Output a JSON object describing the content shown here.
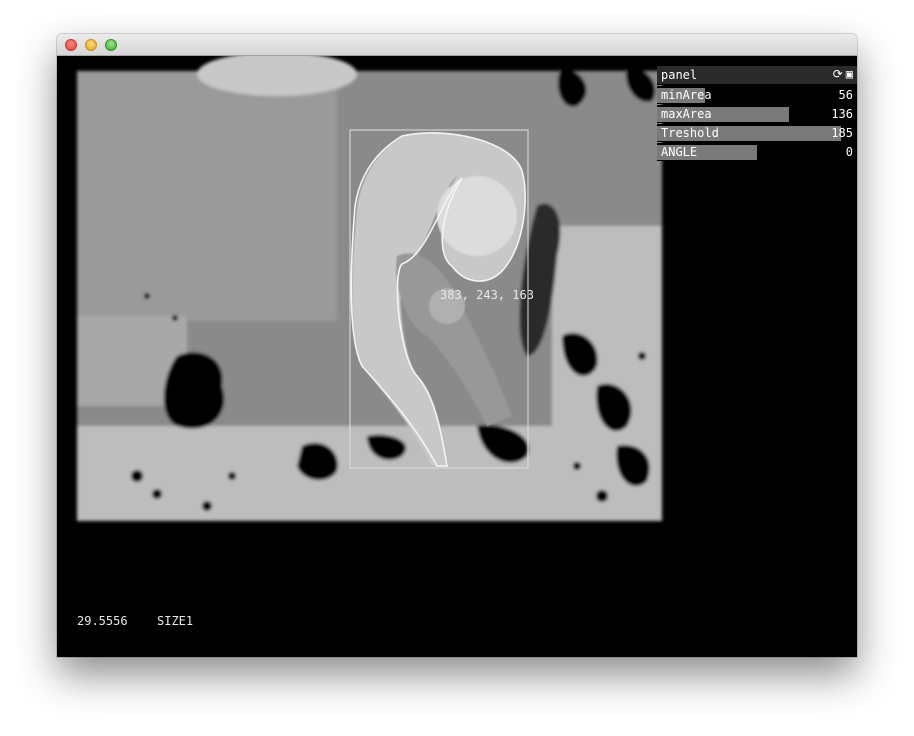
{
  "window": {
    "title": "",
    "controls": [
      "close",
      "minimize",
      "zoom"
    ]
  },
  "panel": {
    "title": "panel",
    "icons": [
      "refresh-icon",
      "save-icon"
    ],
    "sliders": [
      {
        "label": "minArea",
        "value": "56",
        "fill": 0.25
      },
      {
        "label": "maxArea",
        "value": "136",
        "fill": 0.66
      },
      {
        "label": "Treshold",
        "value": "185",
        "fill": 0.92
      },
      {
        "label": "ANGLE",
        "value": "0",
        "fill": 0.5
      }
    ]
  },
  "overlay": {
    "coords": "383, 243, 163"
  },
  "status": {
    "fps": "29.5556",
    "size": "SIZE1"
  }
}
